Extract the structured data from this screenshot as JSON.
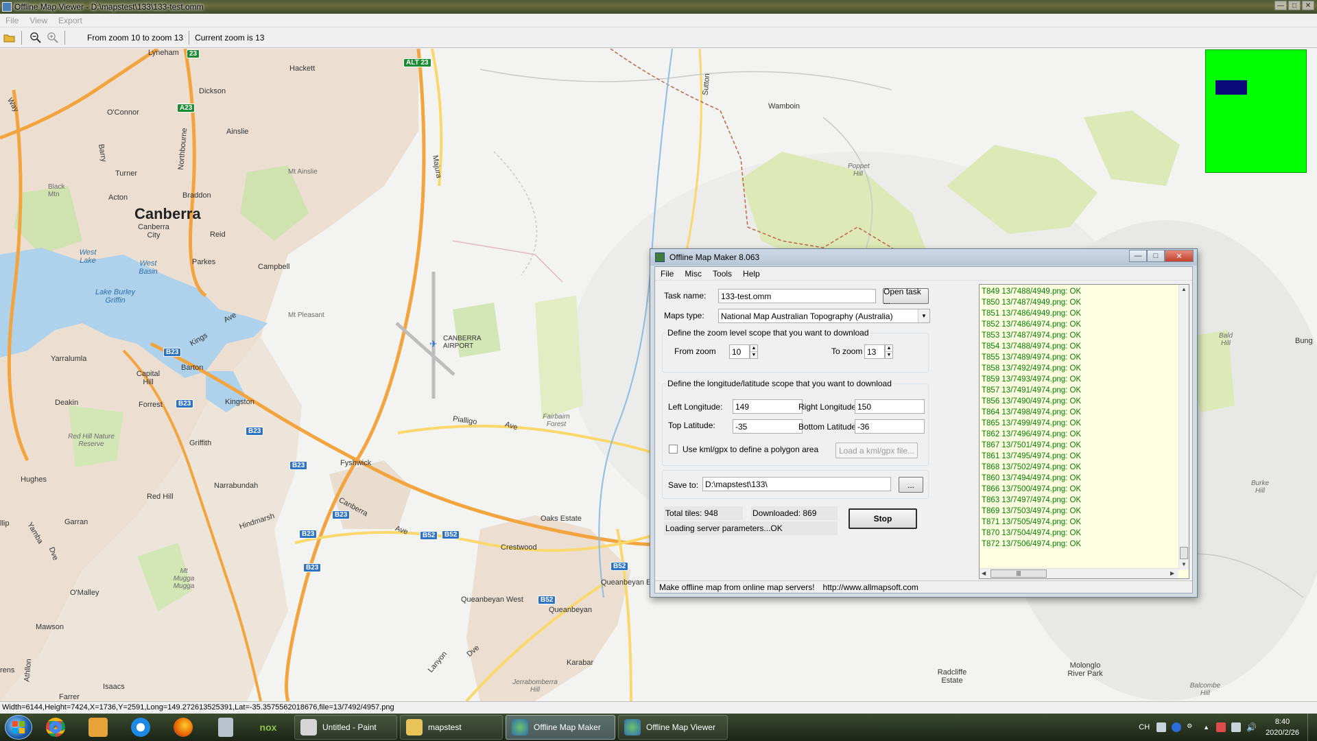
{
  "viewer": {
    "title": "Offline Map Viewer - D:\\mapstest\\133\\133-test.omm",
    "menu": [
      "File",
      "View",
      "Export"
    ],
    "toolbar": {
      "zoom_range": "From zoom 10 to zoom 13",
      "current_zoom": "Current zoom is 13"
    },
    "status": "Width=6144,Height=7424,X=1736,Y=2591,Long=149.272613525391,Lat=-35.3575562018676,file=13/7492/4957.png"
  },
  "map": {
    "labels": {
      "lyneham": "Lyneham",
      "hackett": "Hackett",
      "dickson": "Dickson",
      "oconnor": "O'Connor",
      "ainslie": "Ainslie",
      "turner": "Turner",
      "mt_ainslie": "Mt Ainslie",
      "black_mtn": "Black Mtn",
      "acton": "Acton",
      "braddon": "Braddon",
      "canberra": "Canberra",
      "canberra_city": "Canberra City",
      "reid": "Reid",
      "west_lake": "West Lake",
      "west_basin": "West Basin",
      "parkes": "Parkes",
      "campbell": "Campbell",
      "lake_burley": "Lake Burley Griffin",
      "mt_pleasant": "Mt Pleasant",
      "canberra_airport": "CANBERRA AIRPORT",
      "yarralumla": "Yarralumla",
      "capital_hill": "Capital Hill",
      "barton": "Barton",
      "kings_ave": "Kings",
      "deakin": "Deakin",
      "forrest": "Forrest",
      "kingston": "Kingston",
      "red_hill_nr": "Red Hill Nature Reserve",
      "griffith": "Griffith",
      "fyshwick": "Fyshwick",
      "hughes": "Hughes",
      "narrabundah": "Narrabundah",
      "red_hill": "Red Hill",
      "garran": "Garran",
      "hindmarsh": "Hindmarsh",
      "canberra_ave": "Canberra",
      "oaks_estate": "Oaks Estate",
      "crestwood": "Crestwood",
      "mt_mugga": "Mt Mugga Mugga",
      "omalley": "O'Malley",
      "queanbeyan_west": "Queanbeyan West",
      "queanbeyan": "Queanbeyan",
      "queanbeyan_east": "Queanbeyan East",
      "mawson": "Mawson",
      "isaacs": "Isaacs",
      "karabar": "Karabar",
      "jerrabomberra": "Jerrabomberra Hill",
      "farrer": "Farrer",
      "lanyon": "Lanyon",
      "wamboin": "Wamboin",
      "poppet_hill": "Poppet Hill",
      "fairbairn_forest": "Fairbairn Forest",
      "pialligo": "Pialligo",
      "ave": "Ave",
      "majura": "Majura",
      "sutton": "Sutton",
      "bald_hill": "Bald Hill",
      "bungendore": "Bung",
      "burke_hill": "Burke Hill",
      "radcliffe": "Radcliffe Estate",
      "molonglo": "Molonglo River Park",
      "balcombe": "Balcombe Hill",
      "barry": "Barry",
      "northbourne": "Northbourne",
      "way": "Way",
      "dve": "Dve",
      "athllon": "Athllon",
      "yamba": "Yamba",
      "ave2": "Ave",
      "lanyon_dve": "Dve",
      "ers": "rens",
      "llip": "llip",
      "kings_ave2": "Ave"
    },
    "shields": {
      "a23_top": "23",
      "alt23": "ALT 23",
      "a23": "A23",
      "b23_a": "B23",
      "b23_b": "B23",
      "b23_c": "B23",
      "b23_d": "B23",
      "b23_e": "B23",
      "b23_f": "B23",
      "b23_g": "B23",
      "b52_a": "B52",
      "b52_b": "B52",
      "b52_c": "B52",
      "b52_d": "B52"
    }
  },
  "dialog": {
    "title": "Offline Map Maker 8.063",
    "menu": [
      "File",
      "Misc",
      "Tools",
      "Help"
    ],
    "task_name_label": "Task name:",
    "task_name": "133-test.omm",
    "open_task": "Open task ...",
    "maps_type_label": "Maps type:",
    "maps_type": "National Map Australian Topography (Australia)",
    "zoom_group": "Define the zoom level scope that you want to download",
    "from_zoom_label": "From zoom",
    "from_zoom": "10",
    "to_zoom_label": "To zoom",
    "to_zoom": "13",
    "lonlat_group": "Define the longitude/latitude scope that you want to download",
    "left_lon_label": "Left Longitude:",
    "left_lon": "149",
    "right_lon_label": "Right Longitude:",
    "right_lon": "150",
    "top_lat_label": "Top Latitude:",
    "top_lat": "-35",
    "bottom_lat_label": "Bottom Latitude:",
    "bottom_lat": "-36",
    "kml_label": "Use kml/gpx to define a polygon area",
    "load_kml": "Load a kml/gpx file...",
    "save_to_label": "Save to:",
    "save_to": "D:\\mapstest\\133\\",
    "browse": "...",
    "total_tiles": "Total tiles: 948",
    "downloaded": "Downloaded: 869",
    "loading": "Loading server parameters...OK",
    "stop": "Stop",
    "status_left": "Make offline map from online map servers!",
    "status_right": "http://www.allmapsoft.com",
    "log": [
      "T849 13/7488/4949.png: OK",
      "T850 13/7487/4949.png: OK",
      "T851 13/7486/4949.png: OK",
      "T852 13/7486/4974.png: OK",
      "T853 13/7487/4974.png: OK",
      "T854 13/7488/4974.png: OK",
      "T855 13/7489/4974.png: OK",
      "T858 13/7492/4974.png: OK",
      "T859 13/7493/4974.png: OK",
      "T857 13/7491/4974.png: OK",
      "T856 13/7490/4974.png: OK",
      "T864 13/7498/4974.png: OK",
      "T865 13/7499/4974.png: OK",
      "T862 13/7496/4974.png: OK",
      "T867 13/7501/4974.png: OK",
      "T861 13/7495/4974.png: OK",
      "T868 13/7502/4974.png: OK",
      "T860 13/7494/4974.png: OK",
      "T866 13/7500/4974.png: OK",
      "T863 13/7497/4974.png: OK",
      "T869 13/7503/4974.png: OK",
      "T871 13/7505/4974.png: OK",
      "T870 13/7504/4974.png: OK",
      "T872 13/7506/4974.png: OK"
    ]
  },
  "taskbar": {
    "tasks": [
      "Untitled - Paint",
      "mapstest",
      "Offline Map Maker",
      "Offline Map Viewer"
    ],
    "pinned": [
      "chrome-icon",
      "media-player-icon",
      "internet-explorer-icon",
      "firefox-icon",
      "calculator-icon",
      "nox-icon"
    ],
    "nox": "nox",
    "tray_lang": "CH",
    "time": "8:40",
    "date": "2020/2/26"
  },
  "colors": {
    "minimap_bg": "#00ff00",
    "minimap_cursor": "#0a0a7a",
    "log_text": "#008000",
    "log_bg": "#ffffe1",
    "water": "#aed1ec",
    "urban": "#efe3d6",
    "park": "#c8e0a8",
    "forest": "#dfeab8",
    "road_major": "#f3a43f",
    "road_minor": "#fbd86b"
  }
}
